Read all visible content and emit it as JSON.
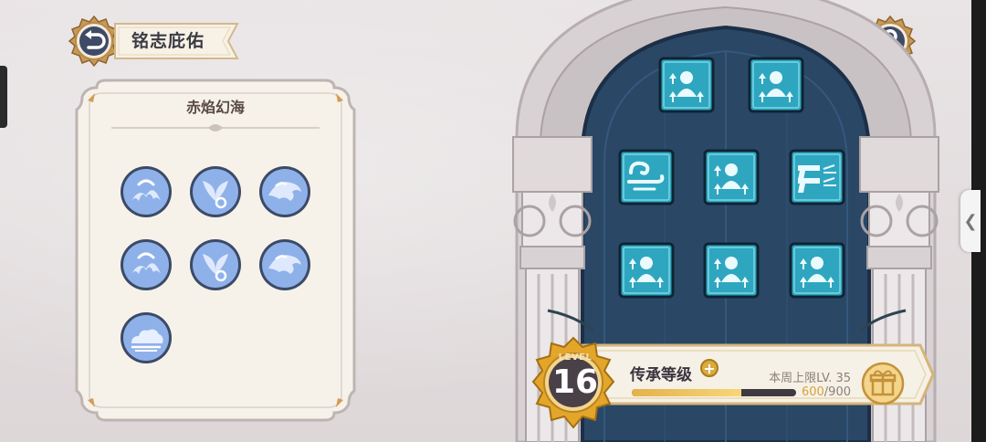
{
  "header": {
    "title": "铭志庇佑",
    "back_icon": "back-arrow-icon",
    "help_icon": "question-mark-icon"
  },
  "panel": {
    "title": "赤焰幻海",
    "badges": [
      {
        "icon": "flame-wave-emblem-icon"
      },
      {
        "icon": "phoenix-wave-emblem-icon"
      },
      {
        "icon": "roaring-wave-emblem-icon"
      },
      {
        "icon": "flame-wave-emblem-icon"
      },
      {
        "icon": "phoenix-wave-emblem-icon"
      },
      {
        "icon": "roaring-wave-emblem-icon"
      },
      {
        "icon": "cloud-emblem-icon"
      }
    ]
  },
  "skills": [
    {
      "icon": "stat-up-figure-icon"
    },
    {
      "icon": "stat-up-figure-icon"
    },
    {
      "icon": "swirl-wind-icon"
    },
    {
      "icon": "stat-up-figure-icon"
    },
    {
      "icon": "twin-pistols-icon"
    },
    {
      "icon": "stat-up-figure-icon"
    },
    {
      "icon": "stat-up-figure-icon"
    },
    {
      "icon": "stat-up-figure-icon"
    }
  ],
  "level": {
    "word": "LEVEL",
    "value": "16",
    "label": "传承等级",
    "weekly_cap": "本周上限LV. 35",
    "xp_current": "600",
    "xp_max": "/900",
    "progress_fraction": 0.667
  },
  "colors": {
    "accent_gold": "#d9a13c",
    "skill_tile": "#2fa6bf",
    "arch_inner": "#2a4766",
    "badge_blue": "#8fb1ea"
  }
}
